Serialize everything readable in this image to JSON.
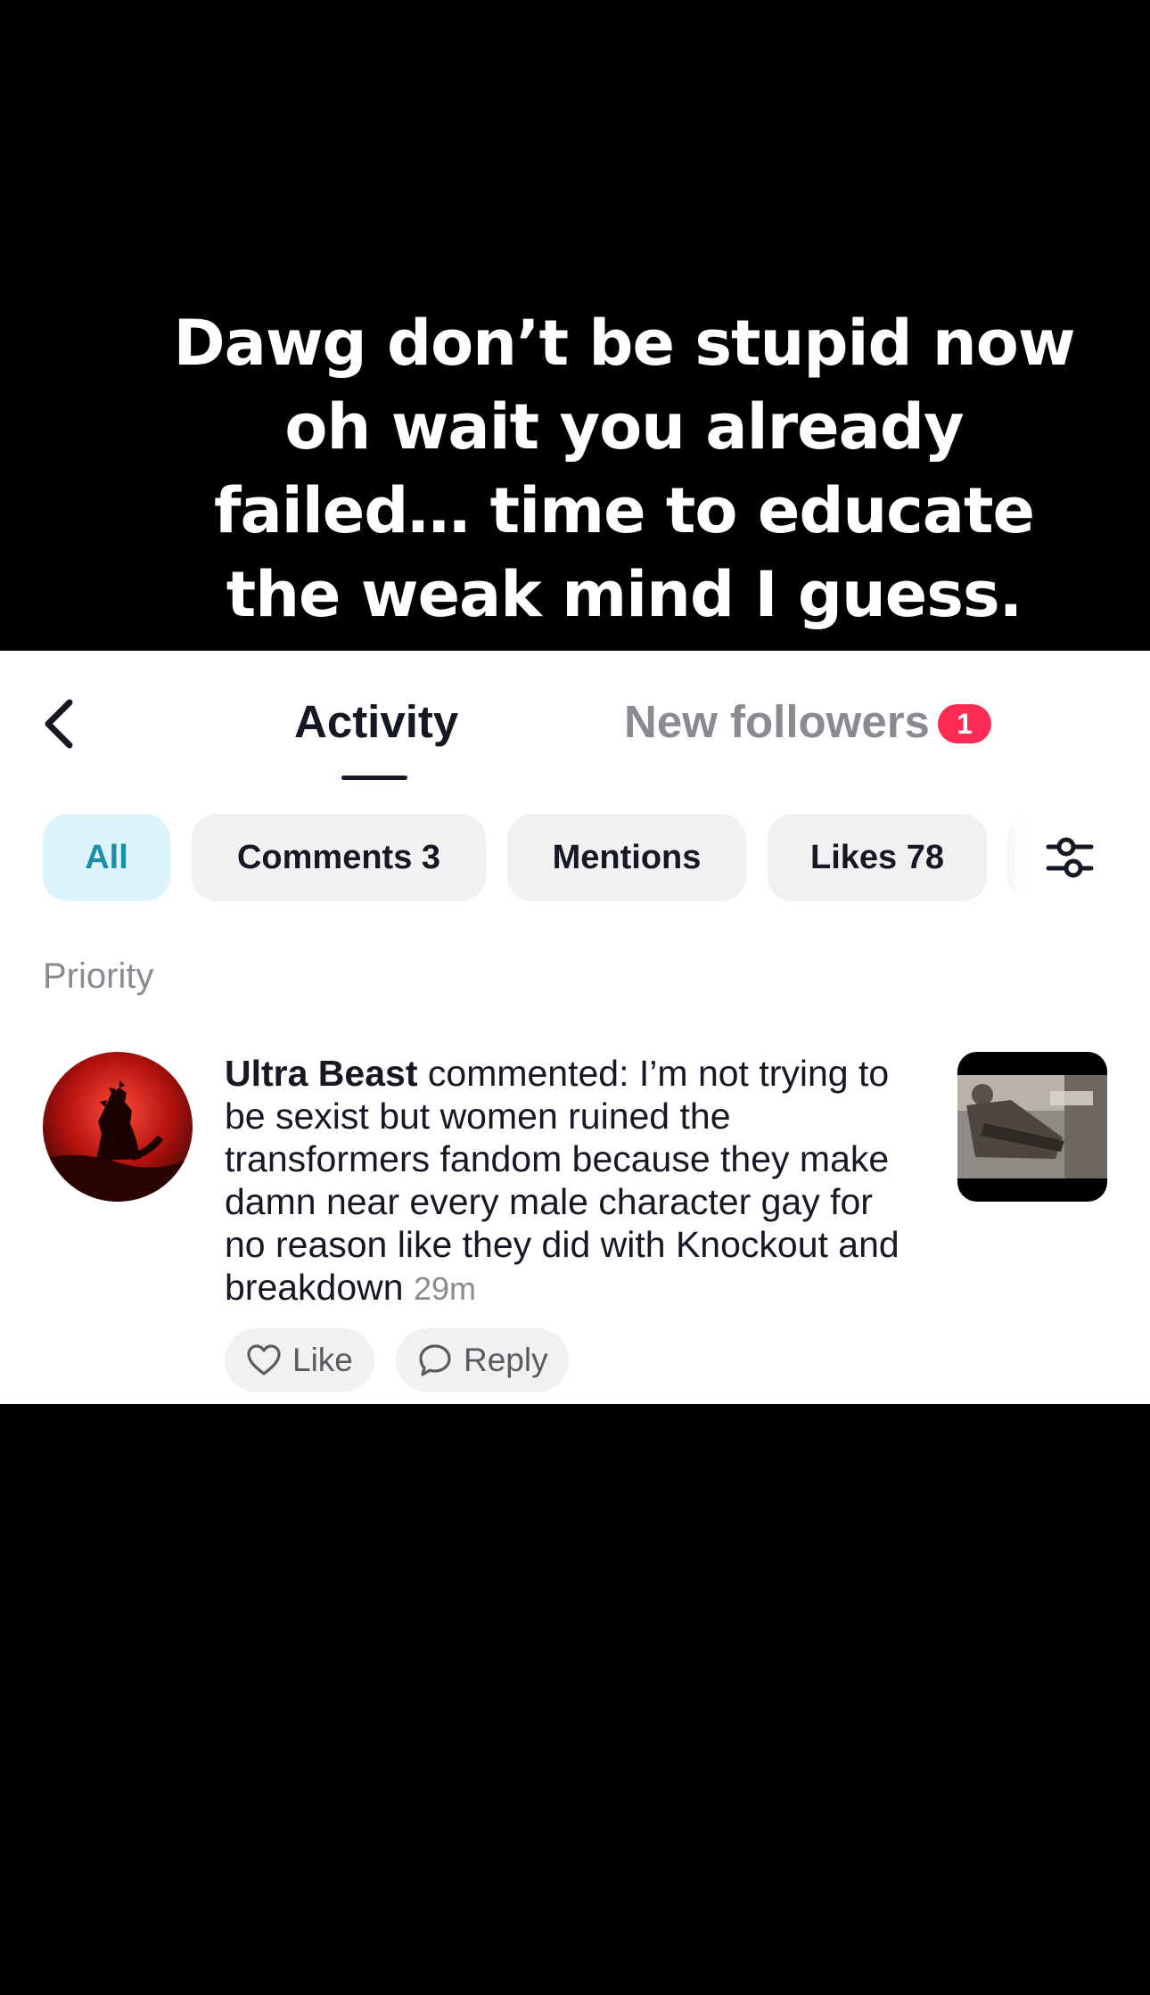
{
  "caption": {
    "text": "Dawg don’t be stupid now oh wait you already failed… time to educate the weak mind I guess."
  },
  "header": {
    "back_icon": "chevron-left-icon",
    "tabs": [
      {
        "label": "Activity",
        "active": true
      },
      {
        "label": "New followers",
        "badge": "1"
      }
    ]
  },
  "filters": {
    "chips": [
      {
        "label": "All",
        "active": true
      },
      {
        "label": "Comments 3"
      },
      {
        "label": "Mentions"
      },
      {
        "label": "Likes 78"
      }
    ],
    "filter_icon": "sliders-icon"
  },
  "section": {
    "title": "Priority"
  },
  "notification": {
    "username": "Ultra Beast",
    "action": "commented:",
    "text": "I’m not trying to be sexist but women ruined the transformers fandom because they make damn near every male character gay for no reason like they did with Knockout and breakdown",
    "time": "29m",
    "actions": {
      "like_label": "Like",
      "reply_label": "Reply"
    }
  },
  "colors": {
    "badge": "#fe2c55",
    "active_chip_bg": "#def4fb",
    "active_chip_text": "#1a8fa8",
    "primary_text": "#161823",
    "secondary_text": "#8a8b91"
  }
}
